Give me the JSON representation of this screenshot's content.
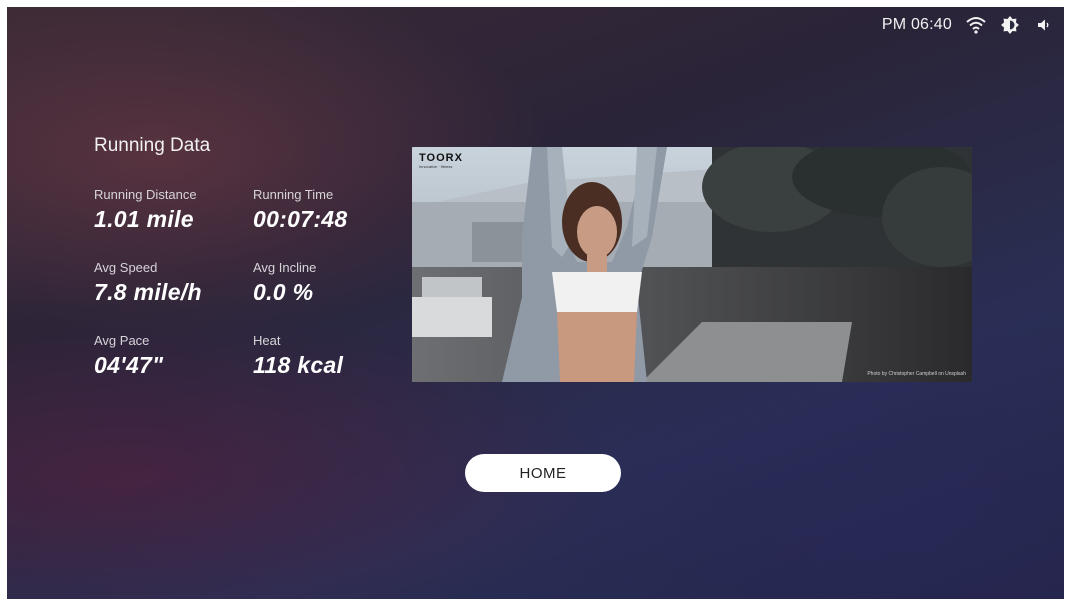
{
  "status_bar": {
    "time": "PM 06:40",
    "icons": [
      "wifi-icon",
      "brightness-icon",
      "volume-icon"
    ]
  },
  "running_data": {
    "title": "Running Data",
    "metrics": [
      {
        "label": "Running Distance",
        "value": "1.01 mile"
      },
      {
        "label": "Running Time",
        "value": "00:07:48"
      },
      {
        "label": "Avg Speed",
        "value": "7.8 mile/h"
      },
      {
        "label": "Avg Incline",
        "value": "0.0 %"
      },
      {
        "label": "Avg Pace",
        "value": "04'47\""
      },
      {
        "label": "Heat",
        "value": "118 kcal"
      }
    ]
  },
  "banner": {
    "brand": "TOORX",
    "tagline": "Innovative · fitness",
    "credit": "Photo by Christopher Campbell on Unsplash"
  },
  "home_button": {
    "label": "HOME"
  },
  "colors": {
    "text": "#ffffff",
    "button_bg": "#ffffff",
    "button_text": "#222222"
  }
}
